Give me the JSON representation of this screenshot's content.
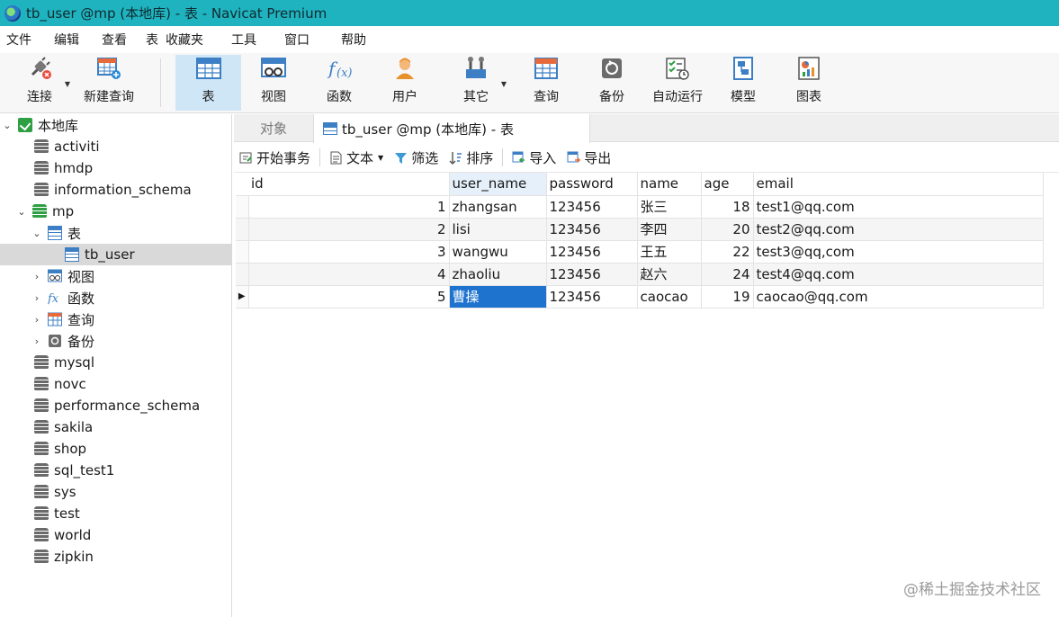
{
  "window": {
    "title": "tb_user @mp (本地库) - 表 - Navicat Premium"
  },
  "menu": [
    "文件",
    "编辑",
    "查看",
    "表",
    "收藏夹",
    "工具",
    "窗口",
    "帮助"
  ],
  "toolbar": {
    "items": [
      {
        "label": "连接",
        "icon": "plug-icon"
      },
      {
        "label": "新建查询",
        "icon": "new-query-icon"
      },
      {
        "label": "表",
        "icon": "table-icon",
        "active": true
      },
      {
        "label": "视图",
        "icon": "view-icon"
      },
      {
        "label": "函数",
        "icon": "function-icon"
      },
      {
        "label": "用户",
        "icon": "user-icon"
      },
      {
        "label": "其它",
        "icon": "tools-icon"
      },
      {
        "label": "查询",
        "icon": "query-icon"
      },
      {
        "label": "备份",
        "icon": "backup-icon"
      },
      {
        "label": "自动运行",
        "icon": "automation-icon"
      },
      {
        "label": "模型",
        "icon": "model-icon"
      },
      {
        "label": "图表",
        "icon": "chart-icon"
      }
    ]
  },
  "navigator": {
    "items": [
      {
        "label": "本地库",
        "type": "connection",
        "expanded": true
      },
      {
        "label": "activiti",
        "type": "database"
      },
      {
        "label": "hmdp",
        "type": "database"
      },
      {
        "label": "information_schema",
        "type": "database"
      },
      {
        "label": "mp",
        "type": "database",
        "expanded": true
      },
      {
        "label": "表",
        "type": "folder-table",
        "expanded": true
      },
      {
        "label": "tb_user",
        "type": "table",
        "selected": true
      },
      {
        "label": "视图",
        "type": "folder-view"
      },
      {
        "label": "函数",
        "type": "folder-function"
      },
      {
        "label": "查询",
        "type": "folder-query"
      },
      {
        "label": "备份",
        "type": "folder-backup"
      },
      {
        "label": "mysql",
        "type": "database"
      },
      {
        "label": "novc",
        "type": "database"
      },
      {
        "label": "performance_schema",
        "type": "database"
      },
      {
        "label": "sakila",
        "type": "database"
      },
      {
        "label": "shop",
        "type": "database"
      },
      {
        "label": "sql_test1",
        "type": "database"
      },
      {
        "label": "sys",
        "type": "database"
      },
      {
        "label": "test",
        "type": "database"
      },
      {
        "label": "world",
        "type": "database"
      },
      {
        "label": "zipkin",
        "type": "database"
      }
    ]
  },
  "tabs": {
    "objects": "对象",
    "active": "tb_user @mp (本地库) - 表"
  },
  "subtoolbar": {
    "begin_transaction": "开始事务",
    "text": "文本",
    "filter": "筛选",
    "sort": "排序",
    "import": "导入",
    "export": "导出"
  },
  "grid": {
    "columns": [
      "id",
      "user_name",
      "password",
      "name",
      "age",
      "email"
    ],
    "selected_column": "user_name",
    "rows": [
      [
        "1",
        "zhangsan",
        "123456",
        "张三",
        "18",
        "test1@qq.com"
      ],
      [
        "2",
        "lisi",
        "123456",
        "李四",
        "20",
        "test2@qq.com"
      ],
      [
        "3",
        "wangwu",
        "123456",
        "王五",
        "22",
        "test3@qq,com"
      ],
      [
        "4",
        "zhaoliu",
        "123456",
        "赵六",
        "24",
        "test4@qq.com"
      ],
      [
        "5",
        "曹操",
        "123456",
        "caocao",
        "19",
        "caocao@qq.com"
      ]
    ],
    "current_row_marker": "▶"
  },
  "watermark": "@稀土掘金技术社区",
  "colors": {
    "titlebar": "#1fb3c0",
    "selection": "#1e73cf",
    "active_tool": "#cfe6f7"
  }
}
